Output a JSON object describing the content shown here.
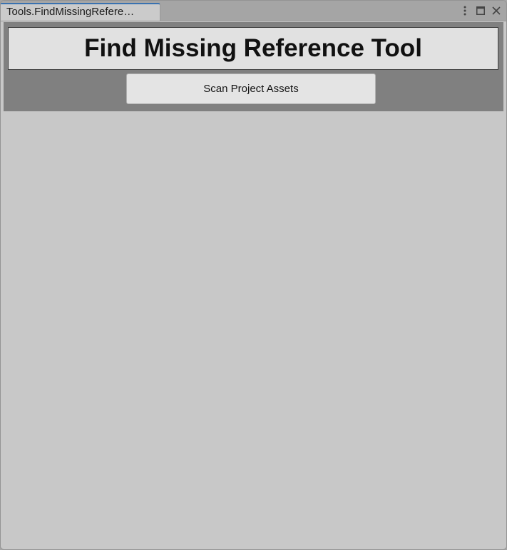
{
  "window": {
    "tab_title": "Tools.FindMissingRefere…"
  },
  "window_controls": {
    "icons": [
      "kebab-menu-icon",
      "maximize-icon",
      "close-icon"
    ]
  },
  "tool": {
    "title": "Find Missing Reference Tool",
    "scan_button_label": "Scan Project Assets"
  },
  "colors": {
    "tab_accent": "#3a72b0",
    "header_panel": "#808080",
    "title_box": "#e1e1e1",
    "body_background": "#c8c8c8"
  }
}
